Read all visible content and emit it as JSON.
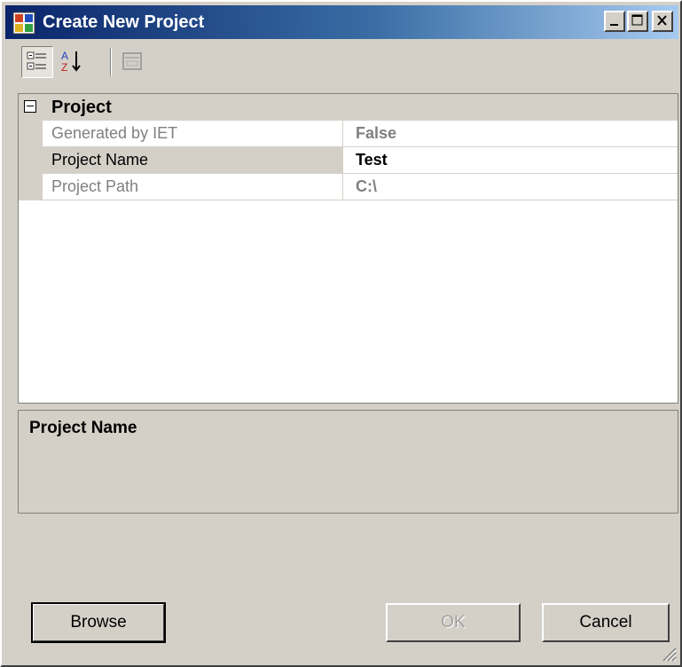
{
  "window": {
    "title": "Create New Project",
    "controls": {
      "minimize": "minimize",
      "maximize": "maximize",
      "close": "close"
    }
  },
  "toolbar": {
    "items": [
      "categorized-icon",
      "alphabetical-sort-icon",
      "property-pages-icon"
    ]
  },
  "property_grid": {
    "category": "Project",
    "rows": [
      {
        "name": "Generated by IET",
        "value": "False",
        "readonly": true
      },
      {
        "name": "Project Name",
        "value": "Test",
        "readonly": false,
        "selected": true
      },
      {
        "name": "Project Path",
        "value": "C:\\",
        "readonly": true
      }
    ]
  },
  "description": {
    "title": "Project Name",
    "text": ""
  },
  "buttons": {
    "browse": "Browse",
    "ok": "OK",
    "cancel": "Cancel"
  },
  "colors": {
    "titlebar_start": "#0a246a",
    "titlebar_end": "#a6caf0",
    "face": "#d4d0c8"
  }
}
